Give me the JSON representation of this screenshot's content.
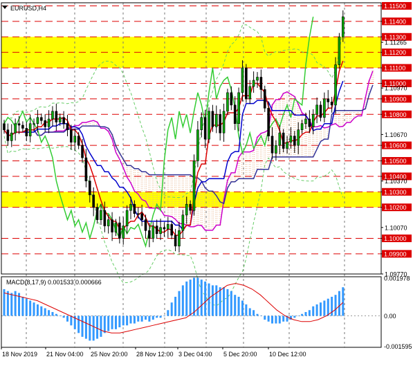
{
  "window": {
    "symbol_label": "EURUSD,H4",
    "menu_icon": "triangle-down-icon"
  },
  "price_axis": {
    "boxed_labels": [
      {
        "text": "1.11500",
        "value": 1.115
      },
      {
        "text": "1.11400",
        "value": 1.114
      },
      {
        "text": "1.11300",
        "value": 1.113
      },
      {
        "text": "1.11200",
        "value": 1.112
      },
      {
        "text": "1.11100",
        "value": 1.111
      },
      {
        "text": "1.11000",
        "value": 1.11
      },
      {
        "text": "1.10900",
        "value": 1.109
      },
      {
        "text": "1.10800",
        "value": 1.108
      },
      {
        "text": "1.10600",
        "value": 1.106
      },
      {
        "text": "1.10500",
        "value": 1.105
      },
      {
        "text": "1.10400",
        "value": 1.104
      },
      {
        "text": "1.10300",
        "value": 1.103
      },
      {
        "text": "1.10200",
        "value": 1.102
      },
      {
        "text": "1.10000",
        "value": 1.1
      },
      {
        "text": "1.09900",
        "value": 1.099
      }
    ],
    "plain_labels": [
      {
        "text": "1.11265",
        "value": 1.11265
      },
      {
        "text": "1.10970",
        "value": 1.1097
      },
      {
        "text": "1.10670",
        "value": 1.1067
      },
      {
        "text": "1.10370",
        "value": 1.1037
      },
      {
        "text": "1.10070",
        "value": 1.1007
      },
      {
        "text": "1.09770",
        "value": 1.0977
      }
    ],
    "colors": {
      "level_line": "#dd0000",
      "label_box": "#dd0000",
      "label_text": "#ffffff"
    }
  },
  "zones": [
    {
      "name": "resistance-zone",
      "from": 1.111,
      "to": 1.113,
      "color": "#ffff00"
    },
    {
      "name": "support-zone",
      "from": 1.102,
      "to": 1.103,
      "color": "#ffff00"
    }
  ],
  "macd": {
    "label": "MACD(8,17,9) 0.001533 0.000666",
    "axis_labels": [
      {
        "text": "0.001978",
        "value": 0.001978
      },
      {
        "text": "0.00",
        "value": 0.0
      },
      {
        "text": "-0.001595",
        "value": -0.001595
      }
    ],
    "colors": {
      "histogram": "#3399ff",
      "signal": "#dd0000"
    }
  },
  "time_axis": {
    "labels": [
      "18 Nov 2019",
      "21 Nov 04:00",
      "25 Nov 20:00",
      "28 Nov 12:00",
      "3 Dec 04:00",
      "5 Dec 20:00",
      "10 Dec 12:00"
    ]
  },
  "colors": {
    "bull_candle": "#00aa00",
    "bear_candle": "#000000",
    "tenkan": "#dd0000",
    "kijun": "#0000cc",
    "chikou": "#33cc33",
    "span_a": "#cc00cc",
    "span_b": "#333399",
    "cloud_dots": "#e8b48a",
    "envelope": "#66cc66",
    "grid": "#777777"
  },
  "chart_data": {
    "type": "candlestick",
    "symbol": "EURUSD",
    "timeframe": "H4",
    "ylim": [
      1.0977,
      1.1152
    ],
    "x_labels": [
      "18 Nov 2019",
      "21 Nov 04:00",
      "25 Nov 20:00",
      "28 Nov 12:00",
      "3 Dec 04:00",
      "5 Dec 20:00",
      "10 Dec 12:00"
    ],
    "close_values": [
      1.107,
      1.1063,
      1.1068,
      1.1074,
      1.1073,
      1.1071,
      1.1066,
      1.1074,
      1.1074,
      1.1078,
      1.1076,
      1.1072,
      1.1077,
      1.1082,
      1.1075,
      1.1078,
      1.1074,
      1.107,
      1.1062,
      1.1066,
      1.106,
      1.1052,
      1.1037,
      1.1028,
      1.102,
      1.1012,
      1.1018,
      1.1008,
      1.1012,
      1.1004,
      1.101,
      1.1,
      1.1008,
      1.1018,
      1.1022,
      1.1016,
      1.1016,
      1.1012,
      1.1005,
      1.1,
      1.1008,
      1.1003,
      1.1007,
      1.1006,
      1.1009,
      1.1002,
      1.0995,
      1.1005,
      1.1015,
      1.1022,
      1.1018,
      1.105,
      1.107,
      1.1078,
      1.1064,
      1.1082,
      1.1072,
      1.108,
      1.1068,
      1.1082,
      1.1094,
      1.1086,
      1.1074,
      1.1094,
      1.111,
      1.109,
      1.1098,
      1.1102,
      1.1104,
      1.1096,
      1.1084,
      1.1066,
      1.1055,
      1.106,
      1.1068,
      1.1058,
      1.1062,
      1.1066,
      1.106,
      1.107,
      1.1074,
      1.1077,
      1.1072,
      1.108,
      1.1086,
      1.1078,
      1.109,
      1.1088,
      1.1086,
      1.1112,
      1.113,
      1.1143
    ],
    "macd_histogram": [
      0.0014,
      0.0013,
      0.0012,
      0.0013,
      0.0012,
      0.001,
      0.0009,
      0.0008,
      0.0007,
      0.0006,
      0.0005,
      0.0004,
      0.0003,
      0.0002,
      0.0001,
      0.0,
      -0.0001,
      -0.0003,
      -0.0005,
      -0.0007,
      -0.0009,
      -0.0011,
      -0.0012,
      -0.0013,
      -0.0013,
      -0.0012,
      -0.0011,
      -0.0009,
      -0.0008,
      -0.0007,
      -0.0007,
      -0.0006,
      -0.0005,
      -0.0005,
      -0.0004,
      -0.0004,
      -0.0003,
      -0.0003,
      -0.0002,
      -0.0003,
      -0.0002,
      -0.0001,
      -0.0001,
      0.0,
      0.0003,
      0.0007,
      0.001,
      0.0013,
      0.0016,
      0.0018,
      0.0019,
      0.002,
      0.002,
      0.0019,
      0.0018,
      0.0017,
      0.0016,
      0.0016,
      0.0015,
      0.0015,
      0.0014,
      0.0013,
      0.0011,
      0.001,
      0.0008,
      0.0006,
      0.0004,
      0.0003,
      0.0001,
      0.0,
      -0.0002,
      -0.0003,
      -0.0004,
      -0.0004,
      -0.0004,
      -0.0003,
      -0.0003,
      -0.0002,
      -0.0001,
      0.0,
      0.0001,
      0.0002,
      0.0003,
      0.0005,
      0.0006,
      0.0007,
      0.0008,
      0.0009,
      0.001,
      0.0011,
      0.0013,
      0.0015
    ],
    "macd_signal": [
      0.0012,
      0.0011,
      0.001,
      0.0009,
      0.0008,
      0.0006,
      0.0004,
      0.0002,
      0.0,
      -0.0002,
      -0.0004,
      -0.0006,
      -0.0008,
      -0.0009,
      -0.0009,
      -0.0008,
      -0.0007,
      -0.0006,
      -0.0005,
      -0.0004,
      -0.0003,
      -0.0002,
      -0.0001,
      0.0002,
      0.0006,
      0.001,
      0.0013,
      0.0016,
      0.0017,
      0.0016,
      0.0014,
      0.0011,
      0.0007,
      0.0003,
      0.0,
      -0.0002,
      -0.0003,
      -0.0003,
      -0.0002,
      0.0,
      0.0003,
      0.0007
    ]
  }
}
